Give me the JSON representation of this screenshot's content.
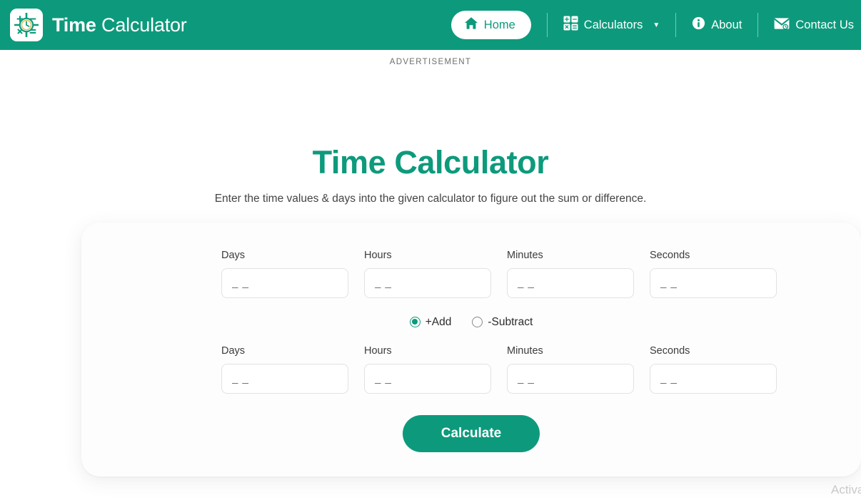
{
  "header": {
    "brand_strong": "Time",
    "brand_light": "Calculator",
    "logo_icon": "calculator-clock-icon",
    "nav": {
      "home": {
        "label": "Home",
        "icon": "home-icon"
      },
      "calculators": {
        "label": "Calculators",
        "icon": "grid-calculator-icon",
        "caret": "▼"
      },
      "about": {
        "label": "About",
        "icon": "info-circle-icon"
      },
      "contact": {
        "label": "Contact Us",
        "icon": "envelope-icon"
      }
    },
    "brand_color": "#0D9A7C"
  },
  "advertisement": {
    "label": "ADVERTISEMENT"
  },
  "main": {
    "title": "Time Calculator",
    "subtitle": "Enter the time values & days into the given calculator to figure out the sum or difference.",
    "title_color": "#0D9A7C"
  },
  "form": {
    "row1": [
      {
        "label": "Days",
        "value": "",
        "placeholder": "_ _"
      },
      {
        "label": "Hours",
        "value": "",
        "placeholder": "_ _"
      },
      {
        "label": "Minutes",
        "value": "",
        "placeholder": "_ _"
      },
      {
        "label": "Seconds",
        "value": "",
        "placeholder": "_ _"
      }
    ],
    "operation": {
      "add": {
        "label": "+Add",
        "selected": true
      },
      "subtract": {
        "label": "-Subtract",
        "selected": false
      }
    },
    "row2": [
      {
        "label": "Days",
        "value": "",
        "placeholder": "_ _"
      },
      {
        "label": "Hours",
        "value": "",
        "placeholder": "_ _"
      },
      {
        "label": "Minutes",
        "value": "",
        "placeholder": "_ _"
      },
      {
        "label": "Seconds",
        "value": "",
        "placeholder": "_ _"
      }
    ],
    "submit_label": "Calculate"
  },
  "watermark": {
    "text": "Activate Windows"
  }
}
